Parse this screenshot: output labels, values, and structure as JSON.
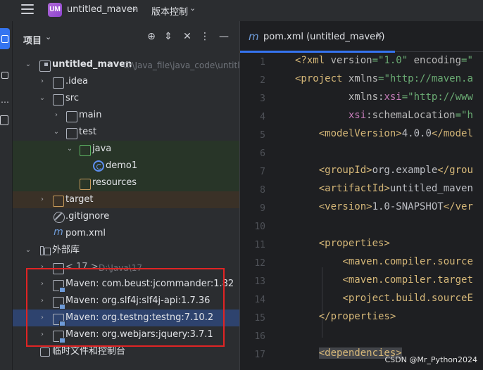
{
  "topbar": {
    "project_badge": "UM",
    "project_name": "untitled_maven",
    "vcs_label": "版本控制"
  },
  "panel": {
    "title": "项目",
    "tree": [
      {
        "label": "untitled_maven",
        "hint": "C:\\Java_file\\java_code\\untitle"
      },
      {
        "label": ".idea"
      },
      {
        "label": "src"
      },
      {
        "label": "main"
      },
      {
        "label": "test"
      },
      {
        "label": "java"
      },
      {
        "label": "demo1"
      },
      {
        "label": "resources"
      },
      {
        "label": "target"
      },
      {
        "label": ".gitignore"
      },
      {
        "label": "pom.xml"
      },
      {
        "label": "外部库"
      },
      {
        "label": "< 17 >",
        "hint": "D:\\Java\\17"
      },
      {
        "label": "Maven: com.beust:jcommander:1.82"
      },
      {
        "label": "Maven: org.slf4j:slf4j-api:1.7.36"
      },
      {
        "label": "Maven: org.testng:testng:7.10.2"
      },
      {
        "label": "Maven: org.webjars:jquery:3.7.1"
      },
      {
        "label": "临时文件和控制台"
      }
    ]
  },
  "editor": {
    "tab_label": "pom.xml (untitled_maven)",
    "line_numbers": [
      "1",
      "2",
      "3",
      "4",
      "5",
      "6",
      "7",
      "8",
      "9",
      "10",
      "11",
      "12",
      "13",
      "14",
      "15",
      "16",
      "17"
    ]
  },
  "colors": {
    "accent": "#3574f0",
    "highlight_box": "#e02424"
  },
  "watermark": "CSDN @Mr_Python2024"
}
